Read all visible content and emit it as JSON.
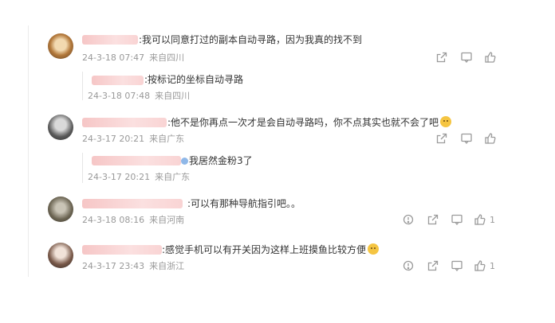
{
  "comments": [
    {
      "text": ":我可以同意打过的副本自动寻路，因为我真的找不到",
      "time": "24-3-18 07:47",
      "location": "来自四川",
      "reply": {
        "text": ":按标记的坐标自动寻路",
        "time": "24-3-18 07:48",
        "location": "来自四川"
      }
    },
    {
      "text": ":他不是你再点一次才是会自动寻路吗，你不点其实也就不会了吧",
      "time": "24-3-17 20:21",
      "location": "来自广东",
      "reply": {
        "text": "我居然金粉3了",
        "time": "24-3-17 20:21",
        "location": "来自广东"
      }
    },
    {
      "text": ":可以有那种导航指引吧。。",
      "time": "24-3-18 08:16",
      "location": "来自河南",
      "likes": "1"
    },
    {
      "text": ":感觉手机可以有开关因为这样上班摸鱼比较方便",
      "time": "24-3-17 23:43",
      "location": "来自浙江",
      "likes": "1"
    }
  ],
  "icons": {
    "share": "share-icon",
    "comment": "comment-icon",
    "like": "like-icon",
    "report": "report-icon"
  },
  "colors": {
    "meta": "#999999",
    "icon": "#9a9a9a",
    "name_blur": "#f6c6c6"
  }
}
